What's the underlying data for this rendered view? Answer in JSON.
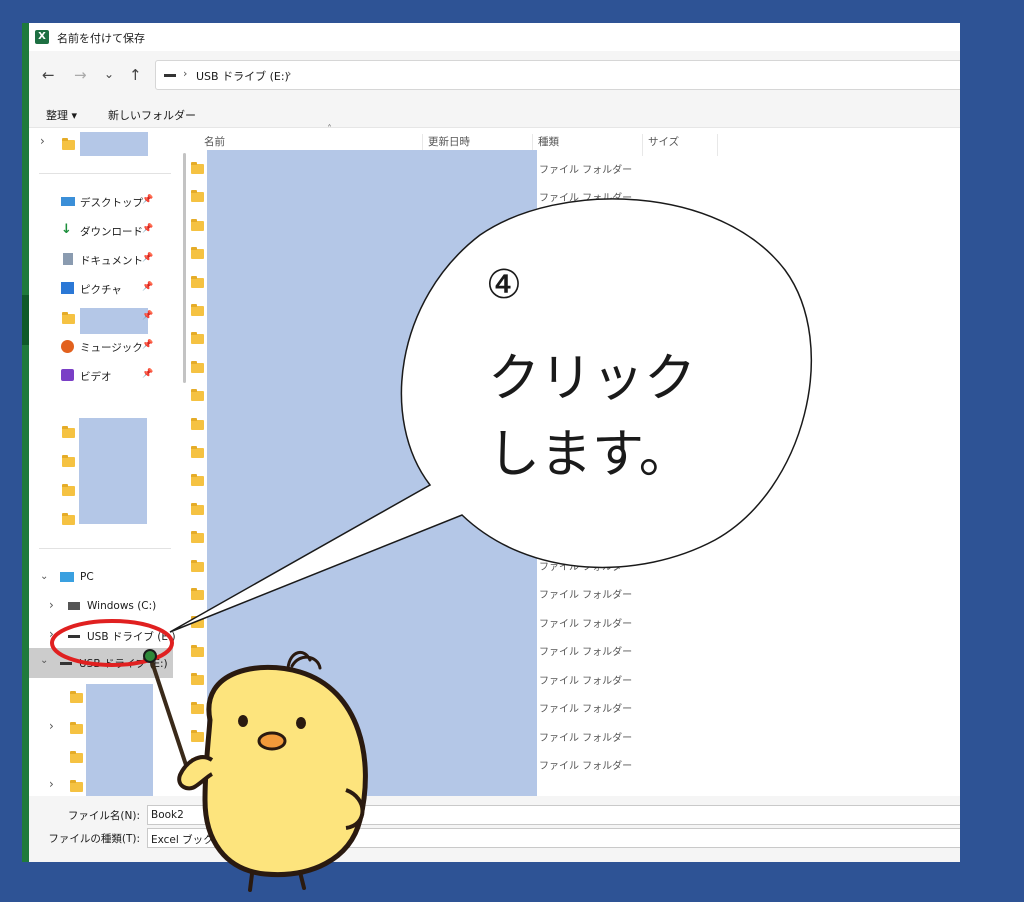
{
  "window": {
    "title": "名前を付けて保存",
    "app_icon": "excel-icon"
  },
  "nav": {
    "back": "←",
    "forward": "→",
    "recent": "⌄",
    "up": "↑",
    "address": {
      "separator": "›",
      "path": "USB ドライブ (E:)"
    }
  },
  "toolbar": {
    "organize": "整理 ▾",
    "new_folder": "新しいフォルダー"
  },
  "sidebar": {
    "quick_access": [
      {
        "label": "デスクトップ",
        "icon": "desktop-icon"
      },
      {
        "label": "ダウンロード",
        "icon": "download-icon"
      },
      {
        "label": "ドキュメント",
        "icon": "document-icon"
      },
      {
        "label": "ピクチャ",
        "icon": "pictures-icon"
      },
      {
        "label": "ミュージック",
        "icon": "music-icon"
      },
      {
        "label": "ビデオ",
        "icon": "video-icon"
      }
    ],
    "pc": "PC",
    "drives": [
      {
        "label": "Windows (C:)"
      },
      {
        "label": "USB ドライブ (E:)"
      },
      {
        "label": "USB ドライブ (E:)",
        "selected": true
      }
    ]
  },
  "columns": {
    "name": "名前",
    "modified": "更新日時",
    "type": "種類",
    "size": "サイズ"
  },
  "file_rows": [
    "ファイル フォルダー",
    "ファイル フォルダー",
    "ファイル フォルダー",
    "ファイル フォルダー",
    "ファイル フォルダー",
    "ファイル フォルダー",
    "ファイル フォルダー",
    "ファイル フォルダー",
    "ファイル フォルダー",
    "ファイル フォルダー"
  ],
  "bottom": {
    "filename_label": "ファイル名(N):",
    "filename_value": "Book2",
    "filetype_label": "ファイルの種類(T):",
    "filetype_value": "Excel ブック"
  },
  "annotation": {
    "step": "④",
    "line1": "クリック",
    "line2": "します。"
  },
  "colors": {
    "background": "#2e5395",
    "redacted": "#b4c7e7",
    "highlight_ring": "#e02020",
    "excel_green": "#1d6f42"
  }
}
